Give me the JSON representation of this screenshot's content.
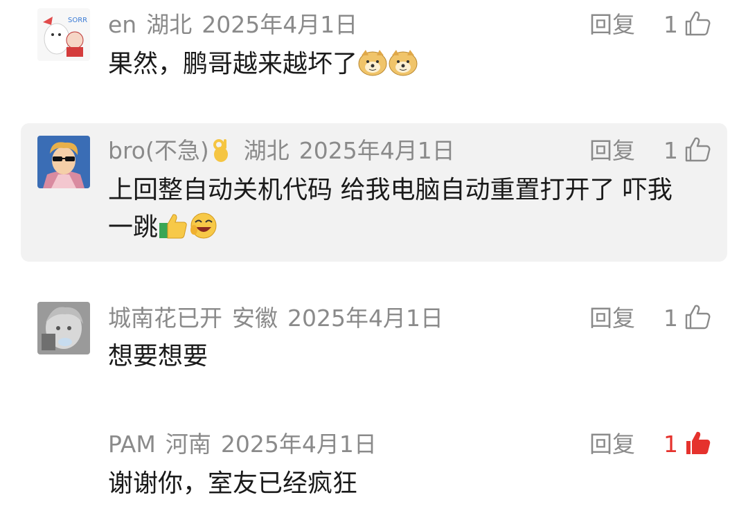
{
  "comments": [
    {
      "username": "en",
      "location": "湖北",
      "date": "2025年4月1日",
      "reply_label": "回复",
      "likes": "1",
      "liked": false,
      "text": "果然，鹏哥越来越坏了",
      "emojis": [
        "doge-emoji",
        "doge-emoji"
      ]
    },
    {
      "username": "bro(不急)",
      "location": "湖北",
      "date": "2025年4月1日",
      "reply_label": "回复",
      "likes": "1",
      "liked": false,
      "text_line1": "上回整自动关机代码 给我电脑自动重置打开了 吓我",
      "text_line2": "一跳",
      "highlighted": true
    },
    {
      "username": "城南花已开",
      "location": "安徽",
      "date": "2025年4月1日",
      "reply_label": "回复",
      "likes": "1",
      "liked": false,
      "text": "想要想要"
    },
    {
      "username": "PAM",
      "location": "河南",
      "date": "2025年4月1日",
      "reply_label": "回复",
      "likes": "1",
      "liked": true,
      "text": "谢谢你，室友已经疯狂"
    }
  ],
  "colors": {
    "meta_gray": "#8a8a8a",
    "liked_red": "#e5322d",
    "highlight_bg": "#f2f2f2"
  }
}
